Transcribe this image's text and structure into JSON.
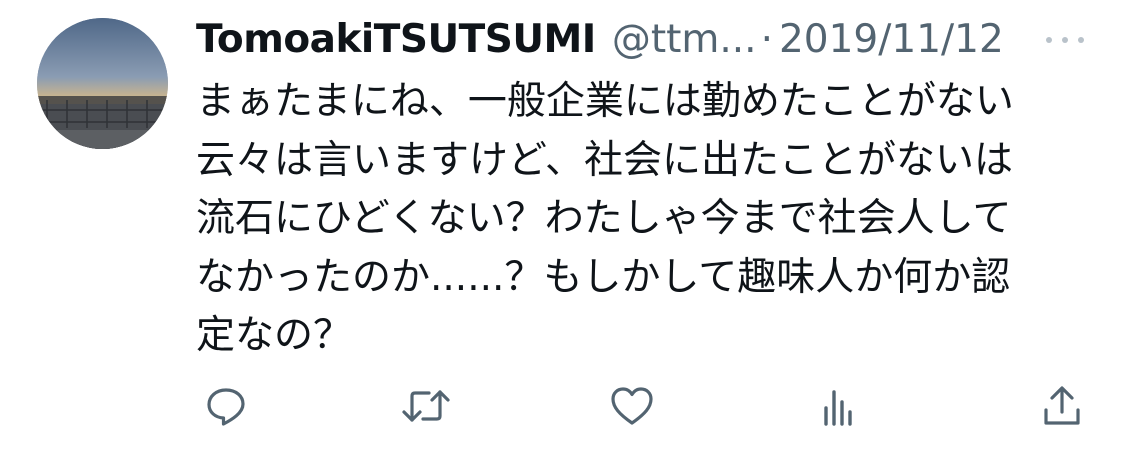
{
  "tweet": {
    "display_name": "TomoakiTSUTSUMI",
    "handle": "@ttm...",
    "separator": "·",
    "date": "2019/11/12",
    "body_lines": [
      "まぁたまにね、一般企業には勤めたことがない",
      "云々は言いますけど、社会に出たことがないは",
      "流石にひどくない？わたしゃ今まで社会人して",
      "なかったのか......？もしかして趣味人か何か認",
      "定なの？"
    ]
  },
  "icons": {
    "more": "more-horizontal-icon",
    "reply": "reply-icon",
    "retweet": "retweet-icon",
    "like": "heart-icon",
    "views": "views-icon",
    "share": "share-icon"
  },
  "colors": {
    "text": "#0f1419",
    "secondary": "#536471",
    "icon": "#536471",
    "more_dots": "#b9c2ca",
    "background": "#ffffff"
  }
}
